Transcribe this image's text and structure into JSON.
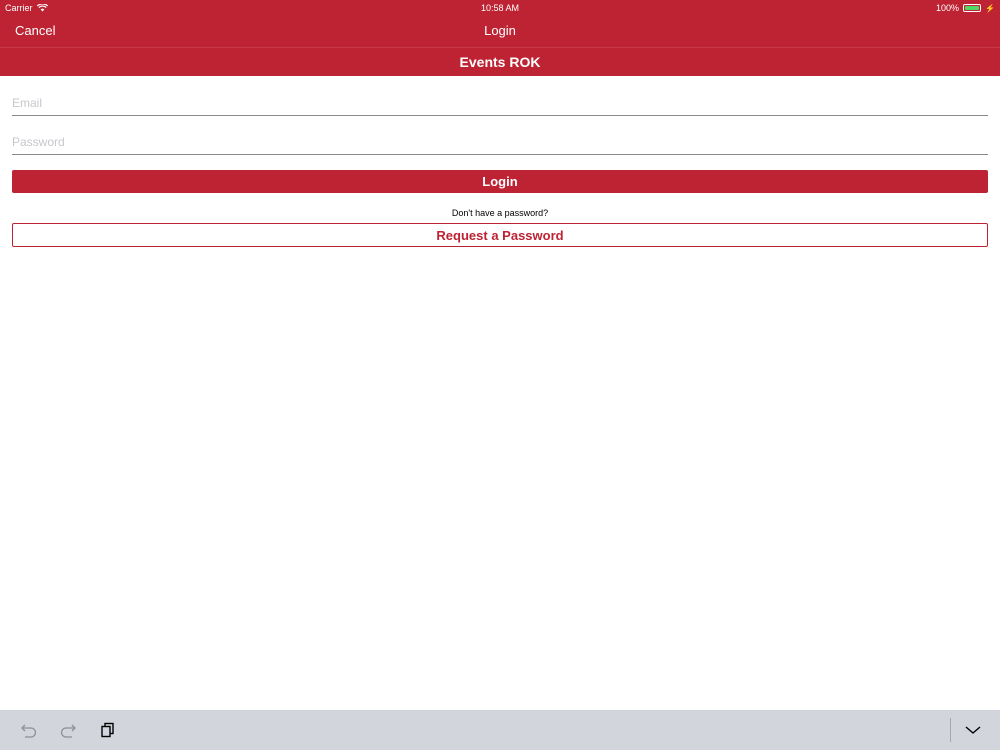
{
  "status_bar": {
    "carrier": "Carrier",
    "time": "10:58 AM",
    "battery_percent": "100%",
    "battery_level": 1.0,
    "icons": [
      "wifi-icon",
      "battery-icon",
      "charging-icon"
    ]
  },
  "nav": {
    "cancel_label": "Cancel",
    "title": "Login"
  },
  "header": {
    "title": "Events ROK"
  },
  "form": {
    "email_placeholder": "Email",
    "email_value": "",
    "password_placeholder": "Password",
    "password_value": "",
    "login_label": "Login",
    "no_password_text": "Don't have a password?",
    "request_label": "Request a Password"
  },
  "keyboard_toolbar": {
    "icons": [
      "undo-icon",
      "redo-icon",
      "paste-icon",
      "dismiss-keyboard-icon"
    ]
  },
  "colors": {
    "brand": "#bd2333",
    "toolbar_bg": "#d2d5db",
    "placeholder": "#c7c7cd",
    "battery_fill": "#4cd964"
  }
}
